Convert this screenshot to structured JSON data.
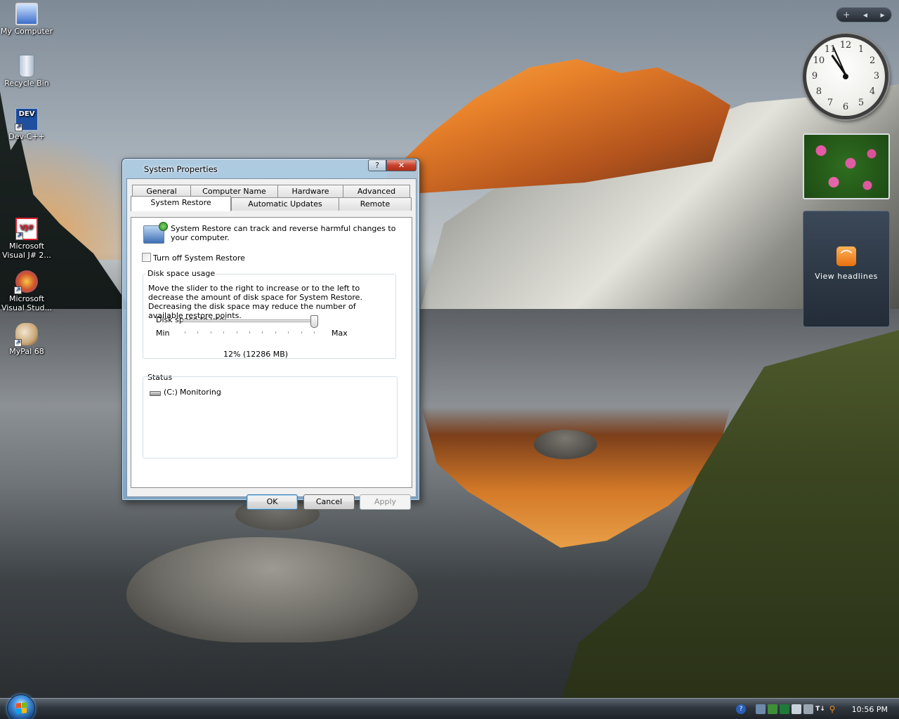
{
  "desktop": {
    "icons": [
      {
        "label": "My Computer",
        "icon": "computer-icon"
      },
      {
        "label": "Recycle Bin",
        "icon": "recycle-bin-icon"
      },
      {
        "label": "Dev-C++",
        "icon": "dev-cpp-icon",
        "badge": "DEV"
      },
      {
        "label": "Microsoft Visual J# 2...",
        "icon": "visual-j-icon",
        "badge": "VJ#"
      },
      {
        "label": "Microsoft Visual Stud...",
        "icon": "visual-studio-icon"
      },
      {
        "label": "MyPal 68",
        "icon": "mypal-icon"
      }
    ],
    "shortcut_arrow": "↗"
  },
  "sidebar": {
    "controls": {
      "add": "+",
      "prev": "◀",
      "next": "▶"
    },
    "clock": {
      "numbers": [
        "12",
        "1",
        "2",
        "3",
        "4",
        "5",
        "6",
        "7",
        "8",
        "9",
        "10",
        "11"
      ]
    },
    "feed": {
      "label": "View headlines"
    }
  },
  "dialog": {
    "title": "System Properties",
    "help_label": "?",
    "close_label": "✕",
    "tabs_row1": [
      "General",
      "Computer Name",
      "Hardware",
      "Advanced"
    ],
    "tabs_row2": [
      "System Restore",
      "Automatic Updates",
      "Remote"
    ],
    "active_tab": "System Restore",
    "intro": "System Restore can track and reverse harmful changes to your computer.",
    "turn_off_label": "Turn off System Restore",
    "turn_off_checked": false,
    "disk_group": {
      "title": "Disk space usage",
      "description": "Move the slider to the right to increase or to the left to decrease the amount of disk space for System Restore. Decreasing the disk space may reduce the number of available restore points.",
      "slider_label": "Disk space to use:",
      "min_label": "Min",
      "max_label": "Max",
      "slider_value_fraction": 0.99,
      "value_text": "12% (12286 MB)"
    },
    "status": {
      "title": "Status",
      "items": [
        {
          "drive": "(C:)",
          "state": "Monitoring"
        }
      ]
    },
    "buttons": {
      "ok": "OK",
      "cancel": "Cancel",
      "apply": "Apply"
    }
  },
  "taskbar": {
    "clock": "10:56 PM",
    "tray_icons": [
      "help-icon",
      "network-icon",
      "security-icon",
      "safely-remove-icon",
      "volume-icon",
      "media-icon",
      "language-icon",
      "search-icon"
    ]
  },
  "colors": {
    "dialog_frame": "#aecde4",
    "close_button": "#c7422c",
    "default_button_border": "#3c7fb1"
  }
}
